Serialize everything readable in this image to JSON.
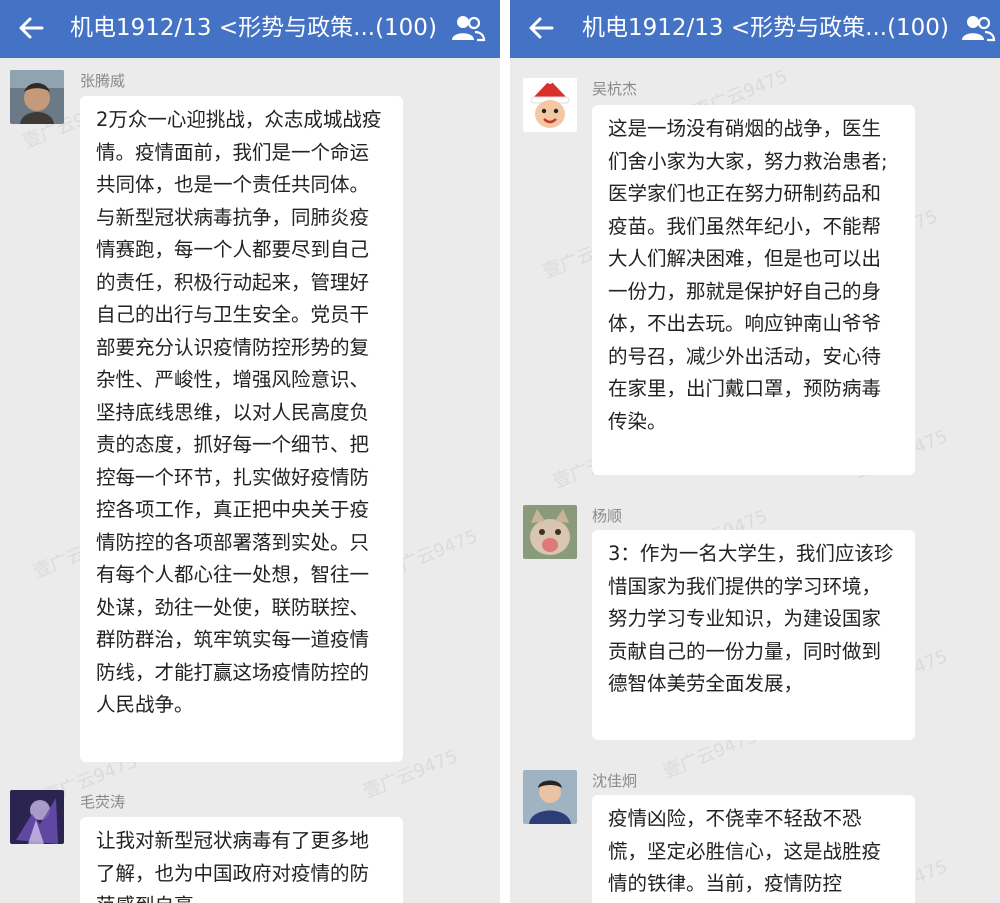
{
  "left": {
    "header": {
      "title": "机电1912/13 <形势与政策...(100)"
    },
    "messages": [
      {
        "sender": "张腾威",
        "text": "2万众一心迎挑战，众志成城战疫情。疫情面前，我们是一个命运共同体，也是一个责任共同体。与新型冠状病毒抗争，同肺炎疫情赛跑，每一个人都要尽到自己的责任，积极行动起来，管理好自己的出行与卫生安全。党员干部要充分认识疫情防控形势的复杂性、严峻性，增强风险意识、坚持底线思维，以对人民高度负责的态度，抓好每一个细节、把控每一个环节，扎实做好疫情防控各项工作，真正把中央关于疫情防控的各项部署落到实处。只有每个人都心往一处想，智往一处谋，劲往一处使，联防联控、群防群治，筑牢筑实每一道疫情防线，才能打赢这场疫情防控的人民战争。"
      },
      {
        "sender": "毛荧涛",
        "text": "让我对新型冠状病毒有了更多地了解，也为中国政府对疫情的防范感到自豪"
      }
    ]
  },
  "right": {
    "header": {
      "title": "机电1912/13 <形势与政策...(100)"
    },
    "messages": [
      {
        "sender": "吴杭杰",
        "text": "这是一场没有硝烟的战争，医生们舍小家为大家，努力救治患者;医学家们也正在努力研制药品和疫苗。我们虽然年纪小，不能帮大人们解决困难，但是也可以出一份力，那就是保护好自己的身体，不出去玩。响应钟南山爷爷的号召，减少外出活动，安心待在家里，出门戴口罩，预防病毒传染。"
      },
      {
        "sender": "杨顺",
        "text": "3：作为一名大学生，我们应该珍惜国家为我们提供的学习环境，努力学习专业知识，为建设国家贡献自己的一份力量，同时做到德智体美劳全面发展，"
      },
      {
        "sender": "沈佳炯",
        "text": " 疫情凶险，不侥幸不轻敌不恐慌，坚定必胜信心，这是战胜疫情的铁律。当前，疫情防控"
      }
    ]
  },
  "colors": {
    "header": "#4472c4",
    "background": "#ebebeb",
    "bubble": "#ffffff"
  },
  "icons": {
    "back": "arrow-left-icon",
    "group": "group-members-icon"
  }
}
